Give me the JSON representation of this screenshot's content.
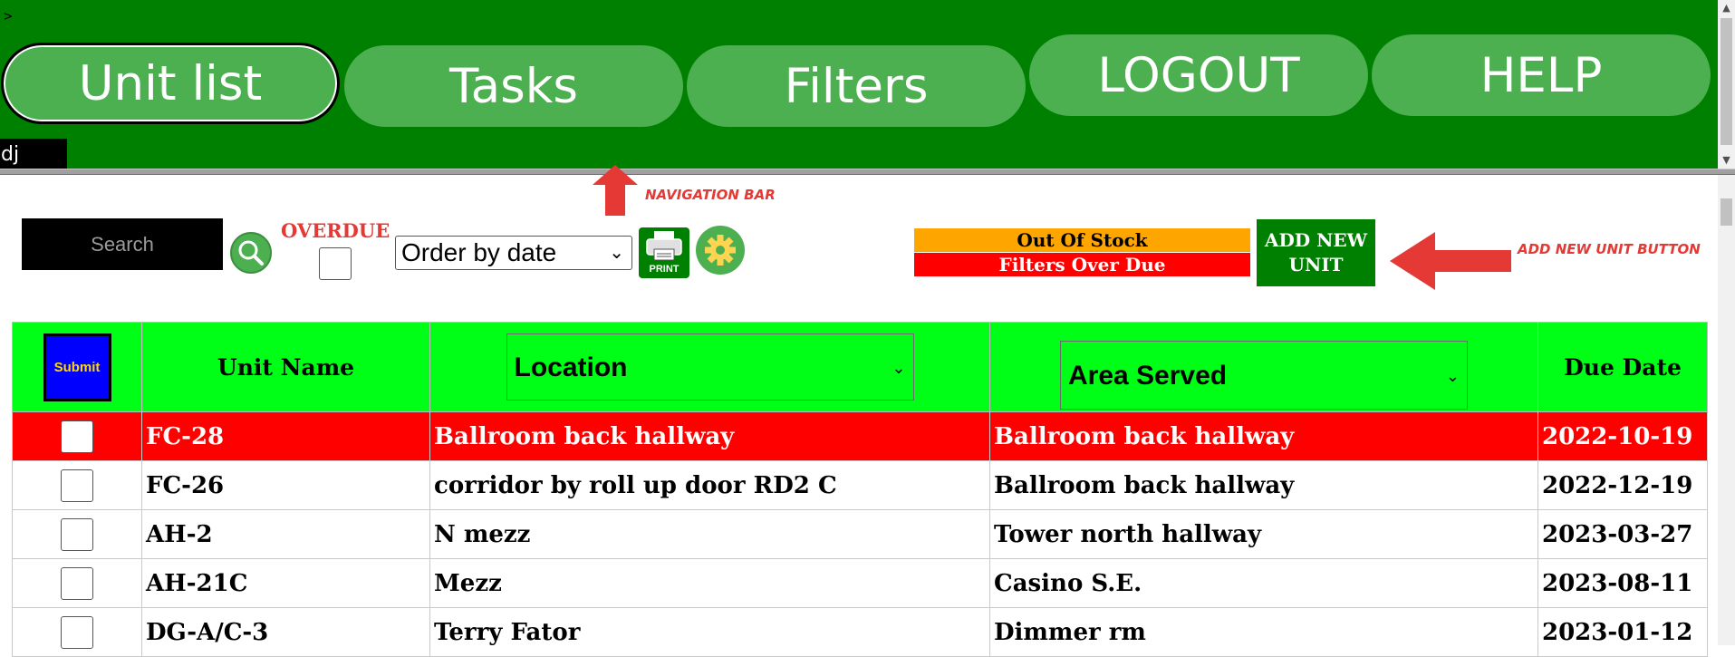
{
  "nav": {
    "prompt": ">",
    "items": [
      "Unit list",
      "Tasks",
      "Filters",
      "LOGOUT",
      "HELP"
    ],
    "user": "dj"
  },
  "annotations": {
    "nav_bar": "NAVIGATION BAR",
    "add_unit": "ADD NEW UNIT BUTTON",
    "color": "#e53935"
  },
  "toolbar": {
    "search_placeholder": "Search",
    "overdue_label": "OVERDUE",
    "order_value": "Order by date",
    "print_label": "PRINT",
    "legend_oos": "Out Of Stock",
    "legend_overdue": "Filters Over Due",
    "add_unit_line1": "ADD NEW",
    "add_unit_line2": "UNIT"
  },
  "table": {
    "submit_label": "Submit",
    "headers": {
      "unit_name": "Unit Name",
      "location": "Location",
      "area_served": "Area Served",
      "due_date": "Due Date"
    },
    "rows": [
      {
        "unit": "FC-28",
        "location": "Ballroom back hallway",
        "area": "Ballroom back hallway",
        "due": "2022-10-19",
        "status": "overdue"
      },
      {
        "unit": "FC-26",
        "location": "corridor by roll up door RD2 C",
        "area": "Ballroom back hallway",
        "due": "2022-12-19",
        "status": "normal"
      },
      {
        "unit": "AH-2",
        "location": "N mezz",
        "area": "Tower north hallway",
        "due": "2023-03-27",
        "status": "normal"
      },
      {
        "unit": "AH-21C",
        "location": "Mezz",
        "area": "Casino S.E.",
        "due": "2023-08-11",
        "status": "normal"
      },
      {
        "unit": "DG-A/C-3",
        "location": "Terry Fator",
        "area": "Dimmer rm",
        "due": "2023-01-12",
        "status": "normal"
      }
    ]
  },
  "colors": {
    "nav_bg": "#008000",
    "nav_button": "#4caf50",
    "header_bg": "#00ff16",
    "overdue_row": "#ff0000",
    "out_of_stock": "#ffa500",
    "submit_bg": "#0000ff"
  }
}
